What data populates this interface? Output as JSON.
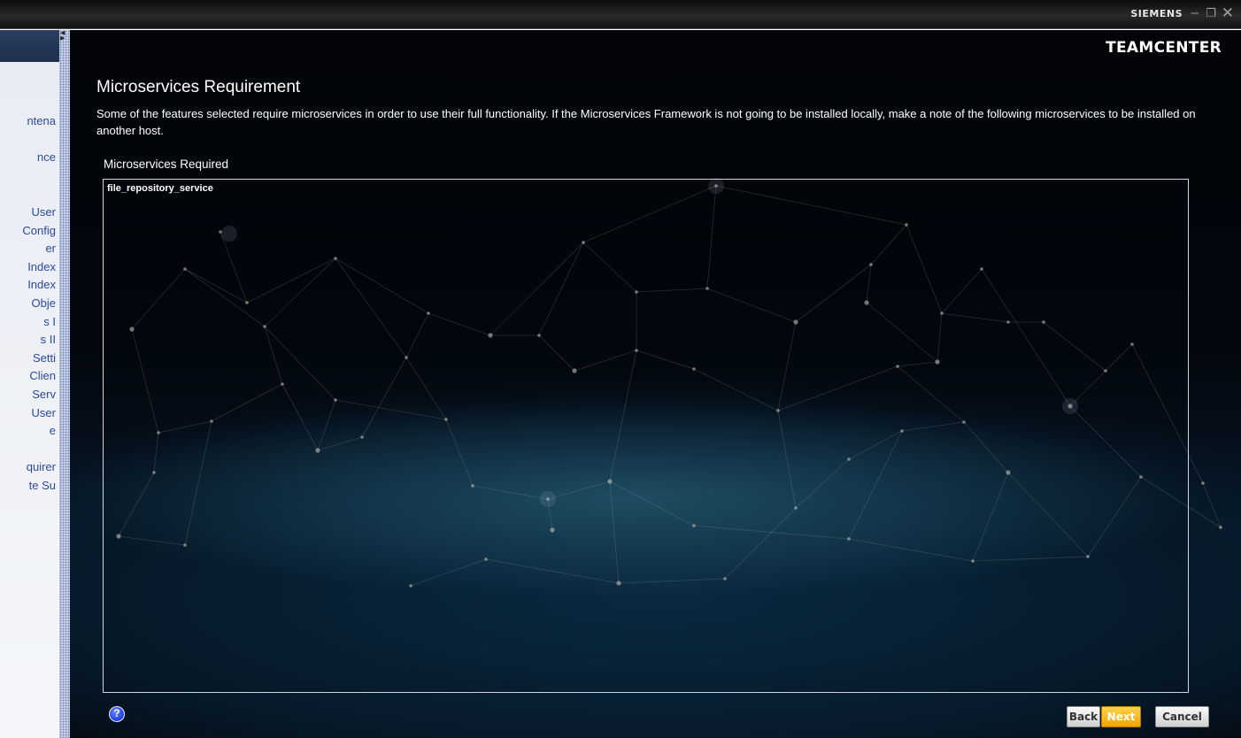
{
  "titlebar": {
    "brand": "SIEMENS",
    "minimize_icon": "minimize-icon",
    "maximize_icon": "restore-icon",
    "close_icon": "close-icon"
  },
  "sidebar": {
    "items": [
      "ntena",
      "",
      "nce",
      "",
      "",
      "User",
      "Config",
      "er",
      "Index",
      "Index",
      "Obje",
      "s I",
      "s II",
      "Setti",
      "Clien",
      "Serv",
      "User",
      "e",
      "",
      "quirer",
      "te Su"
    ]
  },
  "main": {
    "product": "TEAMCENTER",
    "title": "Microservices Requirement",
    "description": "Some of the features selected require microservices in order to use their full functionality.  If the Microservices Framework is not going to be installed locally, make a note of the following microservices to be installed on another host.",
    "list_label": "Microservices Required",
    "microservices": [
      "file_repository_service"
    ]
  },
  "footer": {
    "help_label": "?",
    "back_label": "Back",
    "next_label": "Next",
    "cancel_label": "Cancel"
  },
  "colors": {
    "background": "#03080f",
    "next_button": "#f5b300",
    "sidebar_text": "#2a4aa0"
  }
}
